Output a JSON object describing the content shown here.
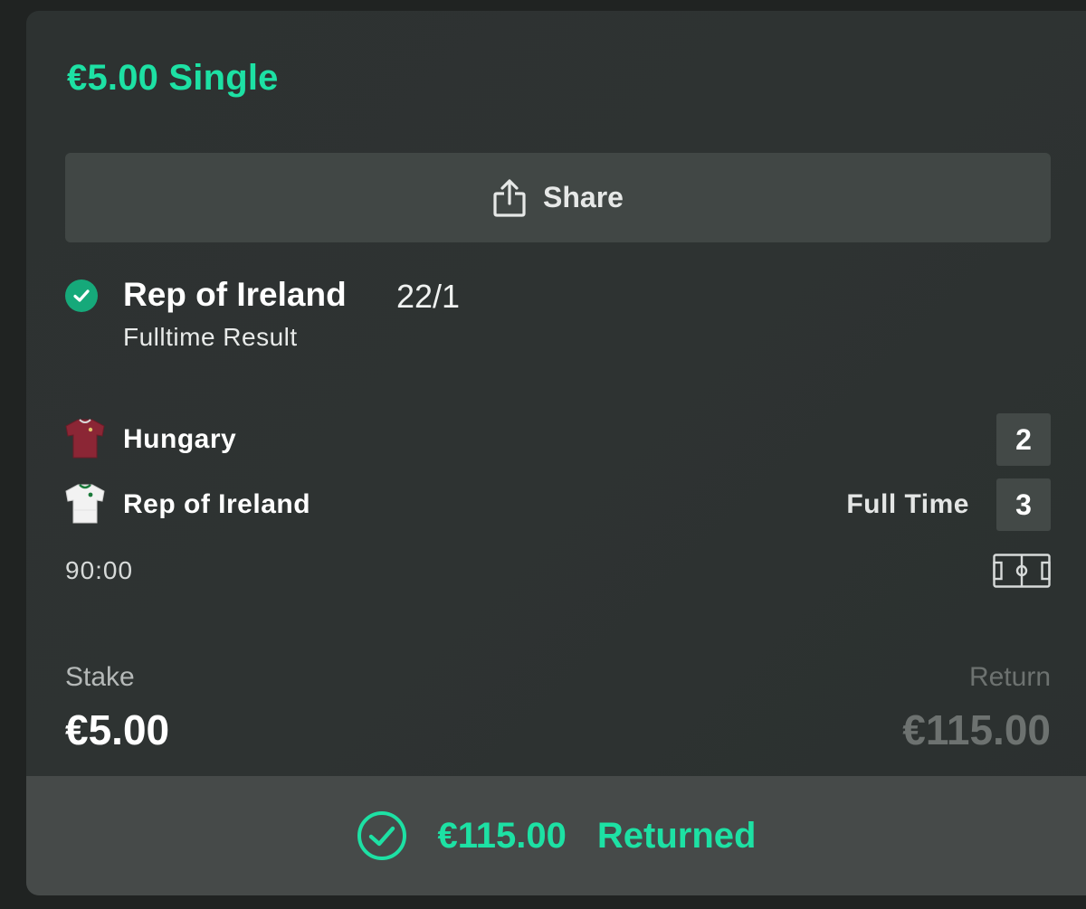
{
  "bet": {
    "title": "€5.00 Single",
    "share_label": "Share",
    "selection": {
      "name": "Rep of Ireland",
      "odds": "22/1",
      "market": "Fulltime Result",
      "status_icon": "check-circle-icon"
    }
  },
  "match": {
    "home": {
      "team": "Hungary",
      "score": "2",
      "kit_color": "#8b2635"
    },
    "away": {
      "team": "Rep of Ireland",
      "score": "3",
      "kit_color": "#f2f2f2"
    },
    "status": "Full Time",
    "clock": "90:00"
  },
  "summary": {
    "stake_label": "Stake",
    "stake_value": "€5.00",
    "return_label": "Return",
    "return_value": "€115.00"
  },
  "footer": {
    "amount": "€115.00",
    "status": "Returned"
  },
  "colors": {
    "accent": "#1de1a4",
    "card_bg": "#2e3332",
    "button_bg": "#414745",
    "footer_bg": "#464a49",
    "check_bg": "#16a97a"
  }
}
